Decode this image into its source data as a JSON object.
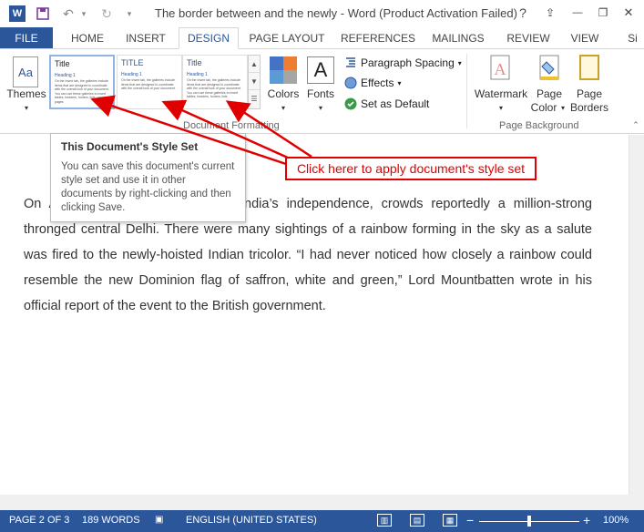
{
  "titlebar": {
    "title": "The border between and the newly - Word (Product Activation Failed)",
    "help": "?",
    "undo": "↶",
    "redo": "↻",
    "minimize": "—",
    "restore": "❐",
    "close": "✕",
    "ribbon_options": "⇪"
  },
  "tabs": {
    "file": "FILE",
    "home": "HOME",
    "insert": "INSERT",
    "design": "DESIGN",
    "page_layout": "PAGE LAYOUT",
    "references": "REFERENCES",
    "mailings": "MAILINGS",
    "review": "REVIEW",
    "view": "VIEW",
    "signin": "Si"
  },
  "ribbon": {
    "themes": {
      "label": "Themes",
      "icon_text": "Aa"
    },
    "gallery": [
      {
        "title": "Title",
        "heading": "Heading 1",
        "body": "On the Insert tab, the galleries include items that are designed to coordinate with the overall look of your document. You can use these galleries to insert tables, headers, footers, lists, cover pages"
      },
      {
        "title": "TITLE",
        "heading": "Heading 1",
        "body": "On the Insert tab, the galleries include items that are designed to coordinate with the overall look of your document."
      },
      {
        "title": "Title",
        "heading": "Heading 1",
        "body": "On the Insert tab, the galleries include items that are designed to coordinate with the overall look of your document. You can use these galleries to insert tables, headers, footers, lists"
      }
    ],
    "colors": {
      "label": "Colors",
      "swatches": [
        "#4472c4",
        "#ed7d31",
        "#5b9bd5",
        "#a5a5a5"
      ]
    },
    "fonts": {
      "label": "Fonts",
      "icon_text": "A"
    },
    "paragraph_spacing": "Paragraph Spacing",
    "effects": "Effects",
    "set_as_default": "Set as Default",
    "group_document_formatting": "Document Formatting",
    "watermark": "Watermark",
    "page_color_line1": "Page",
    "page_color_line2": "Color",
    "page_borders_line1": "Page",
    "page_borders_line2": "Borders",
    "group_page_background": "Page Background"
  },
  "tooltip": {
    "title": "This Document's Style Set",
    "body": "You can save this document's current style set and use it in other documents by right-clicking and then clicking Save."
  },
  "callout": {
    "text": "Click herer to apply document's style set"
  },
  "document": {
    "paragraph": "On August 15, 1947, the day of India’s independence, crowds reportedly a million-strong thronged central Delhi. There were many sightings of a rainbow forming in the sky as a salute was fired to the newly-hoisted Indian tricolor. “I had never noticed how closely a rainbow could resemble the new Dominion flag of saffron, white and green,” Lord Mountbatten wrote in his official report of the event to the British government."
  },
  "statusbar": {
    "page": "PAGE 2 OF 3",
    "words": "189 WORDS",
    "language": "ENGLISH (UNITED STATES)",
    "zoom_minus": "−",
    "zoom_plus": "+",
    "zoom": "100%"
  }
}
